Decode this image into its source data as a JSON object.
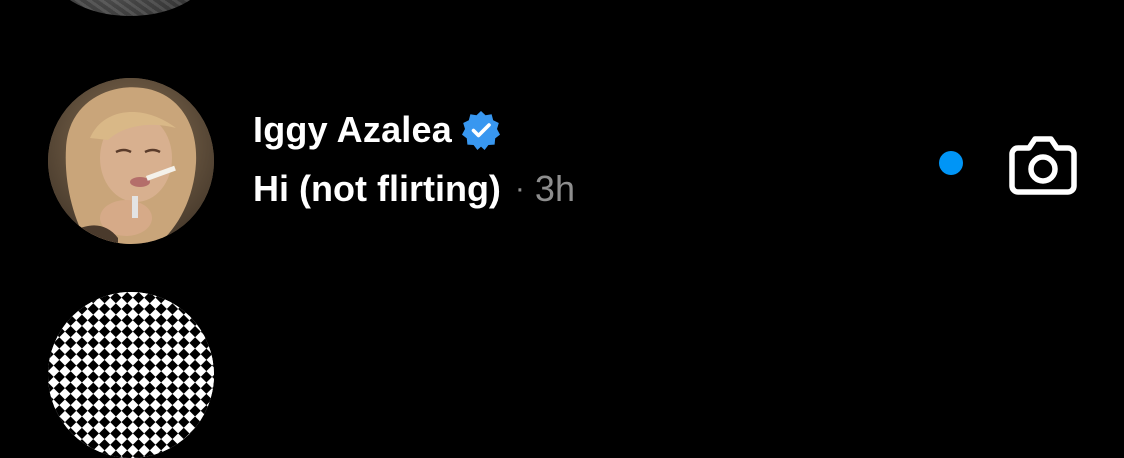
{
  "conversation": {
    "name": "Iggy Azalea",
    "verified_icon": "verified-badge-icon",
    "preview": "Hi (not flirting)",
    "separator": "·",
    "time": "3h",
    "unread": true,
    "action_icon": "camera-icon"
  },
  "colors": {
    "background": "#000000",
    "text_primary": "#ffffff",
    "text_secondary": "#8e8e8e",
    "verified_blue": "#3897f0",
    "unread_dot": "#0095f6"
  }
}
